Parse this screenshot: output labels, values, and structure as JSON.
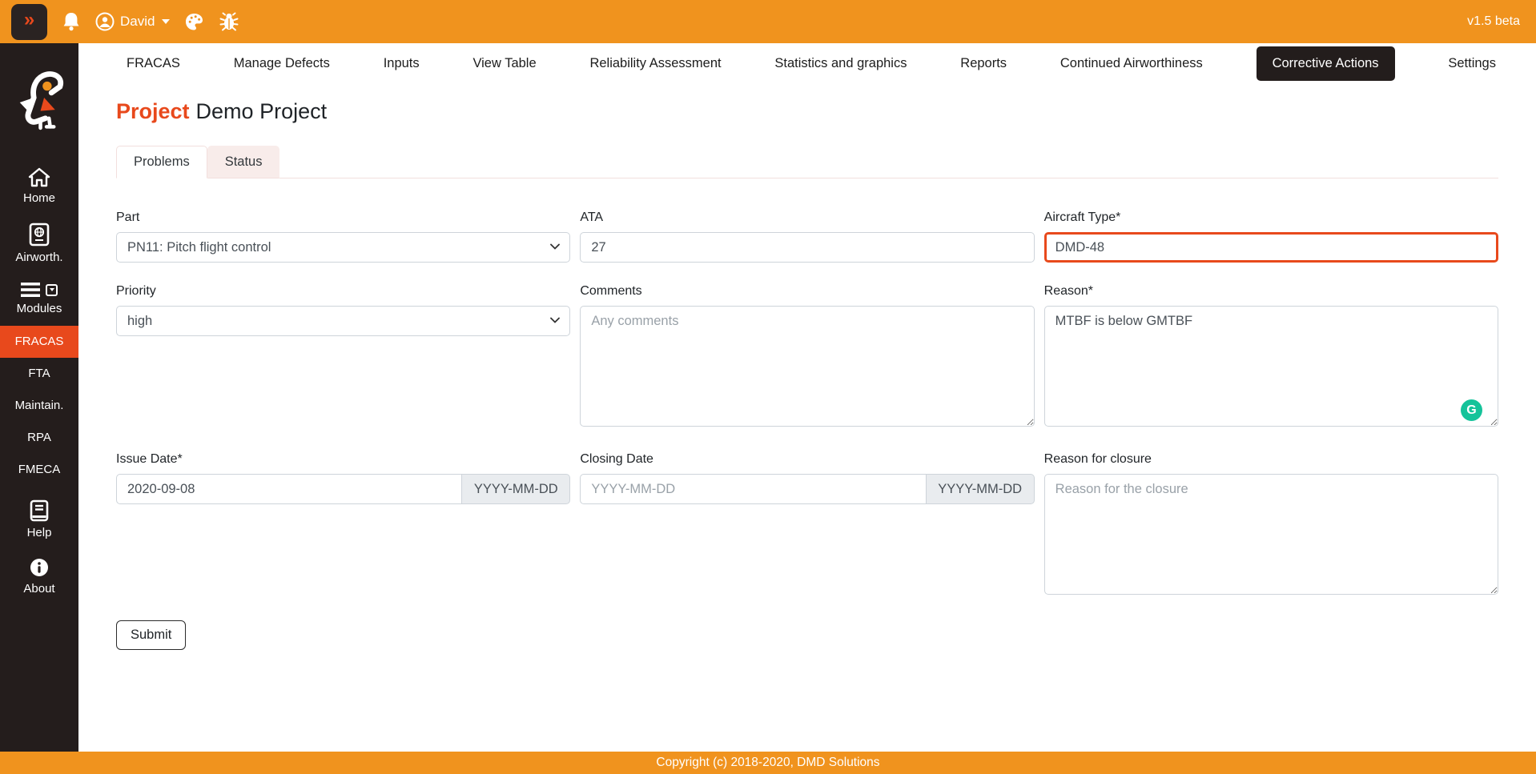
{
  "topbar": {
    "collapse_glyph": "»",
    "user_name": "David",
    "version": "v1.5 beta"
  },
  "sidebar": {
    "items": [
      {
        "label": "Home",
        "icon": "home-icon"
      },
      {
        "label": "Airworth.",
        "icon": "passport-icon"
      },
      {
        "label": "Modules",
        "icon": "menu-icon"
      },
      {
        "label": "FRACAS",
        "icon": null,
        "active": true
      },
      {
        "label": "FTA",
        "icon": null
      },
      {
        "label": "Maintain.",
        "icon": null
      },
      {
        "label": "RPA",
        "icon": null
      },
      {
        "label": "FMECA",
        "icon": null
      },
      {
        "label": "Help",
        "icon": "book-icon"
      },
      {
        "label": "About",
        "icon": "info-icon"
      }
    ]
  },
  "nav": {
    "items": [
      "FRACAS",
      "Manage Defects",
      "Inputs",
      "View Table",
      "Reliability Assessment",
      "Statistics and graphics",
      "Reports",
      "Continued Airworthiness",
      "Corrective Actions",
      "Settings"
    ],
    "active_item": "Corrective Actions"
  },
  "page": {
    "title_prefix": "Project",
    "title_name": "Demo Project"
  },
  "tabs": [
    {
      "label": "Problems",
      "active": true
    },
    {
      "label": "Status",
      "active": false
    }
  ],
  "form": {
    "part": {
      "label": "Part",
      "value": "PN11: Pitch flight control"
    },
    "ata": {
      "label": "ATA",
      "value": "27"
    },
    "aircraft_type": {
      "label": "Aircraft Type*",
      "value": "DMD-48"
    },
    "priority": {
      "label": "Priority",
      "value": "high"
    },
    "comments": {
      "label": "Comments",
      "placeholder": "Any comments"
    },
    "reason": {
      "label": "Reason*",
      "value": "MTBF is below GMTBF"
    },
    "issue_date": {
      "label": "Issue Date*",
      "value": "2020-09-08",
      "addon": "YYYY-MM-DD"
    },
    "closing_date": {
      "label": "Closing Date",
      "placeholder": "YYYY-MM-DD",
      "addon": "YYYY-MM-DD"
    },
    "closure_reason": {
      "label": "Reason for closure",
      "placeholder": "Reason for the closure"
    },
    "submit_label": "Submit",
    "grammarly_glyph": "G"
  },
  "footer": {
    "copyright": "Copyright (c) 2018-2020, DMD Solutions"
  },
  "icons": [
    "collapse-chevrons-icon",
    "bell-icon",
    "user-icon",
    "caret-down-icon",
    "palette-icon",
    "bug-icon",
    "logo-bird-icon",
    "home-icon",
    "passport-icon",
    "menu-icon",
    "dropdown-caret-icon",
    "book-icon",
    "info-icon",
    "select-chevron-icon",
    "grammarly-icon"
  ],
  "colors": {
    "accent_red_orange": "#E8491C",
    "brand_orange": "#F0931E",
    "dark_brown": "#241D1C",
    "grammarly_green": "#15C39A",
    "input_border": "#CED4DA",
    "addon_bg": "#E9ECEF",
    "tab_pink": "#F8ECEA"
  }
}
